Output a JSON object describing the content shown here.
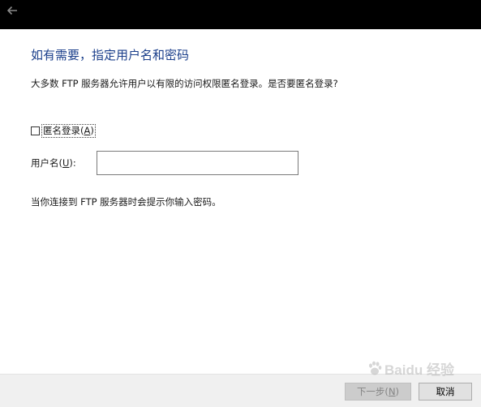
{
  "titlebar": {
    "back_icon": "back-arrow-icon"
  },
  "content": {
    "heading": "如有需要，指定用户名和密码",
    "description": "大多数 FTP 服务器允许用户以有限的访问权限匿名登录。是否要匿名登录?",
    "anonymous_checkbox": {
      "label_text": "匿名登录(",
      "accelerator": "A",
      "label_close": ")",
      "checked": false
    },
    "username": {
      "label_text": "用户名(",
      "accelerator": "U",
      "label_close": "):",
      "value": ""
    },
    "hint": "当你连接到 FTP 服务器时会提示你输入密码。"
  },
  "footer": {
    "next_label_text": "下一步(",
    "next_accelerator": "N",
    "next_label_close": ")",
    "next_enabled": false,
    "cancel_label": "取消"
  },
  "watermark": {
    "logo_icon": "baidu-paw-icon",
    "text": "Baidu 经验"
  },
  "colors": {
    "titlebar": "#000000",
    "heading": "#1b3f8b",
    "footer": "#f0f0f0"
  }
}
